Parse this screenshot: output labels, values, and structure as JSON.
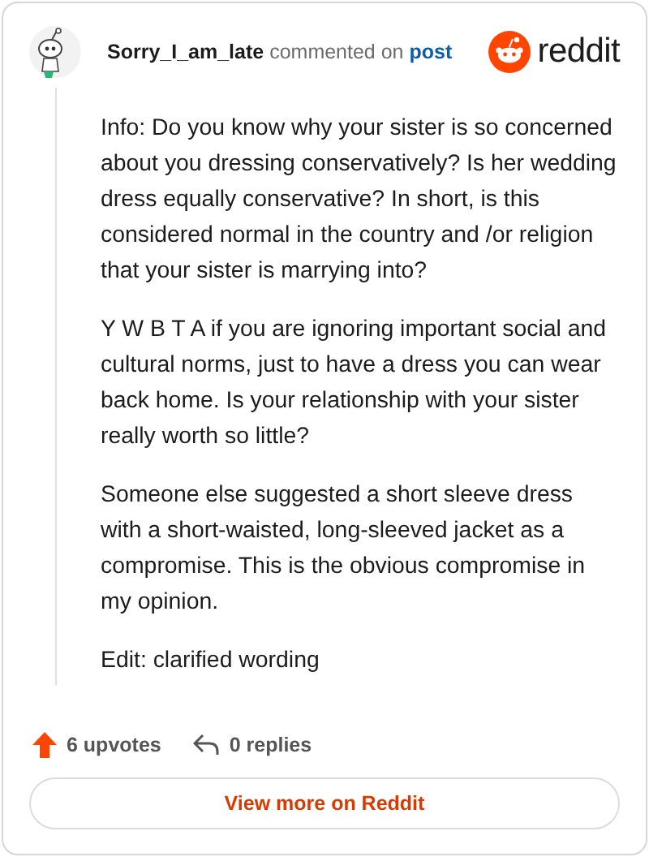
{
  "comment": {
    "author": "Sorry_I_am_late",
    "action": "commented on",
    "link": "post"
  },
  "brand": {
    "wordmark": "reddit"
  },
  "paragraphs": [
    "Info: Do you know why your sister is so concerned about you dressing conservatively? Is her wedding dress equally conservative? In short, is this considered normal in the country and /or religion that your sister is marrying into?",
    "Y W B T A if you are ignoring important social and cultural norms, just to have a dress you can wear back home. Is your relationship with your sister really worth so little?",
    "Someone else suggested a short sleeve dress with a short-waisted, long-sleeved jacket as a compromise. This is the obvious compromise in my opinion.",
    "Edit: clarified wording"
  ],
  "footer": {
    "upvotes": "6 upvotes",
    "replies": "0 replies"
  },
  "button": "View more on Reddit"
}
